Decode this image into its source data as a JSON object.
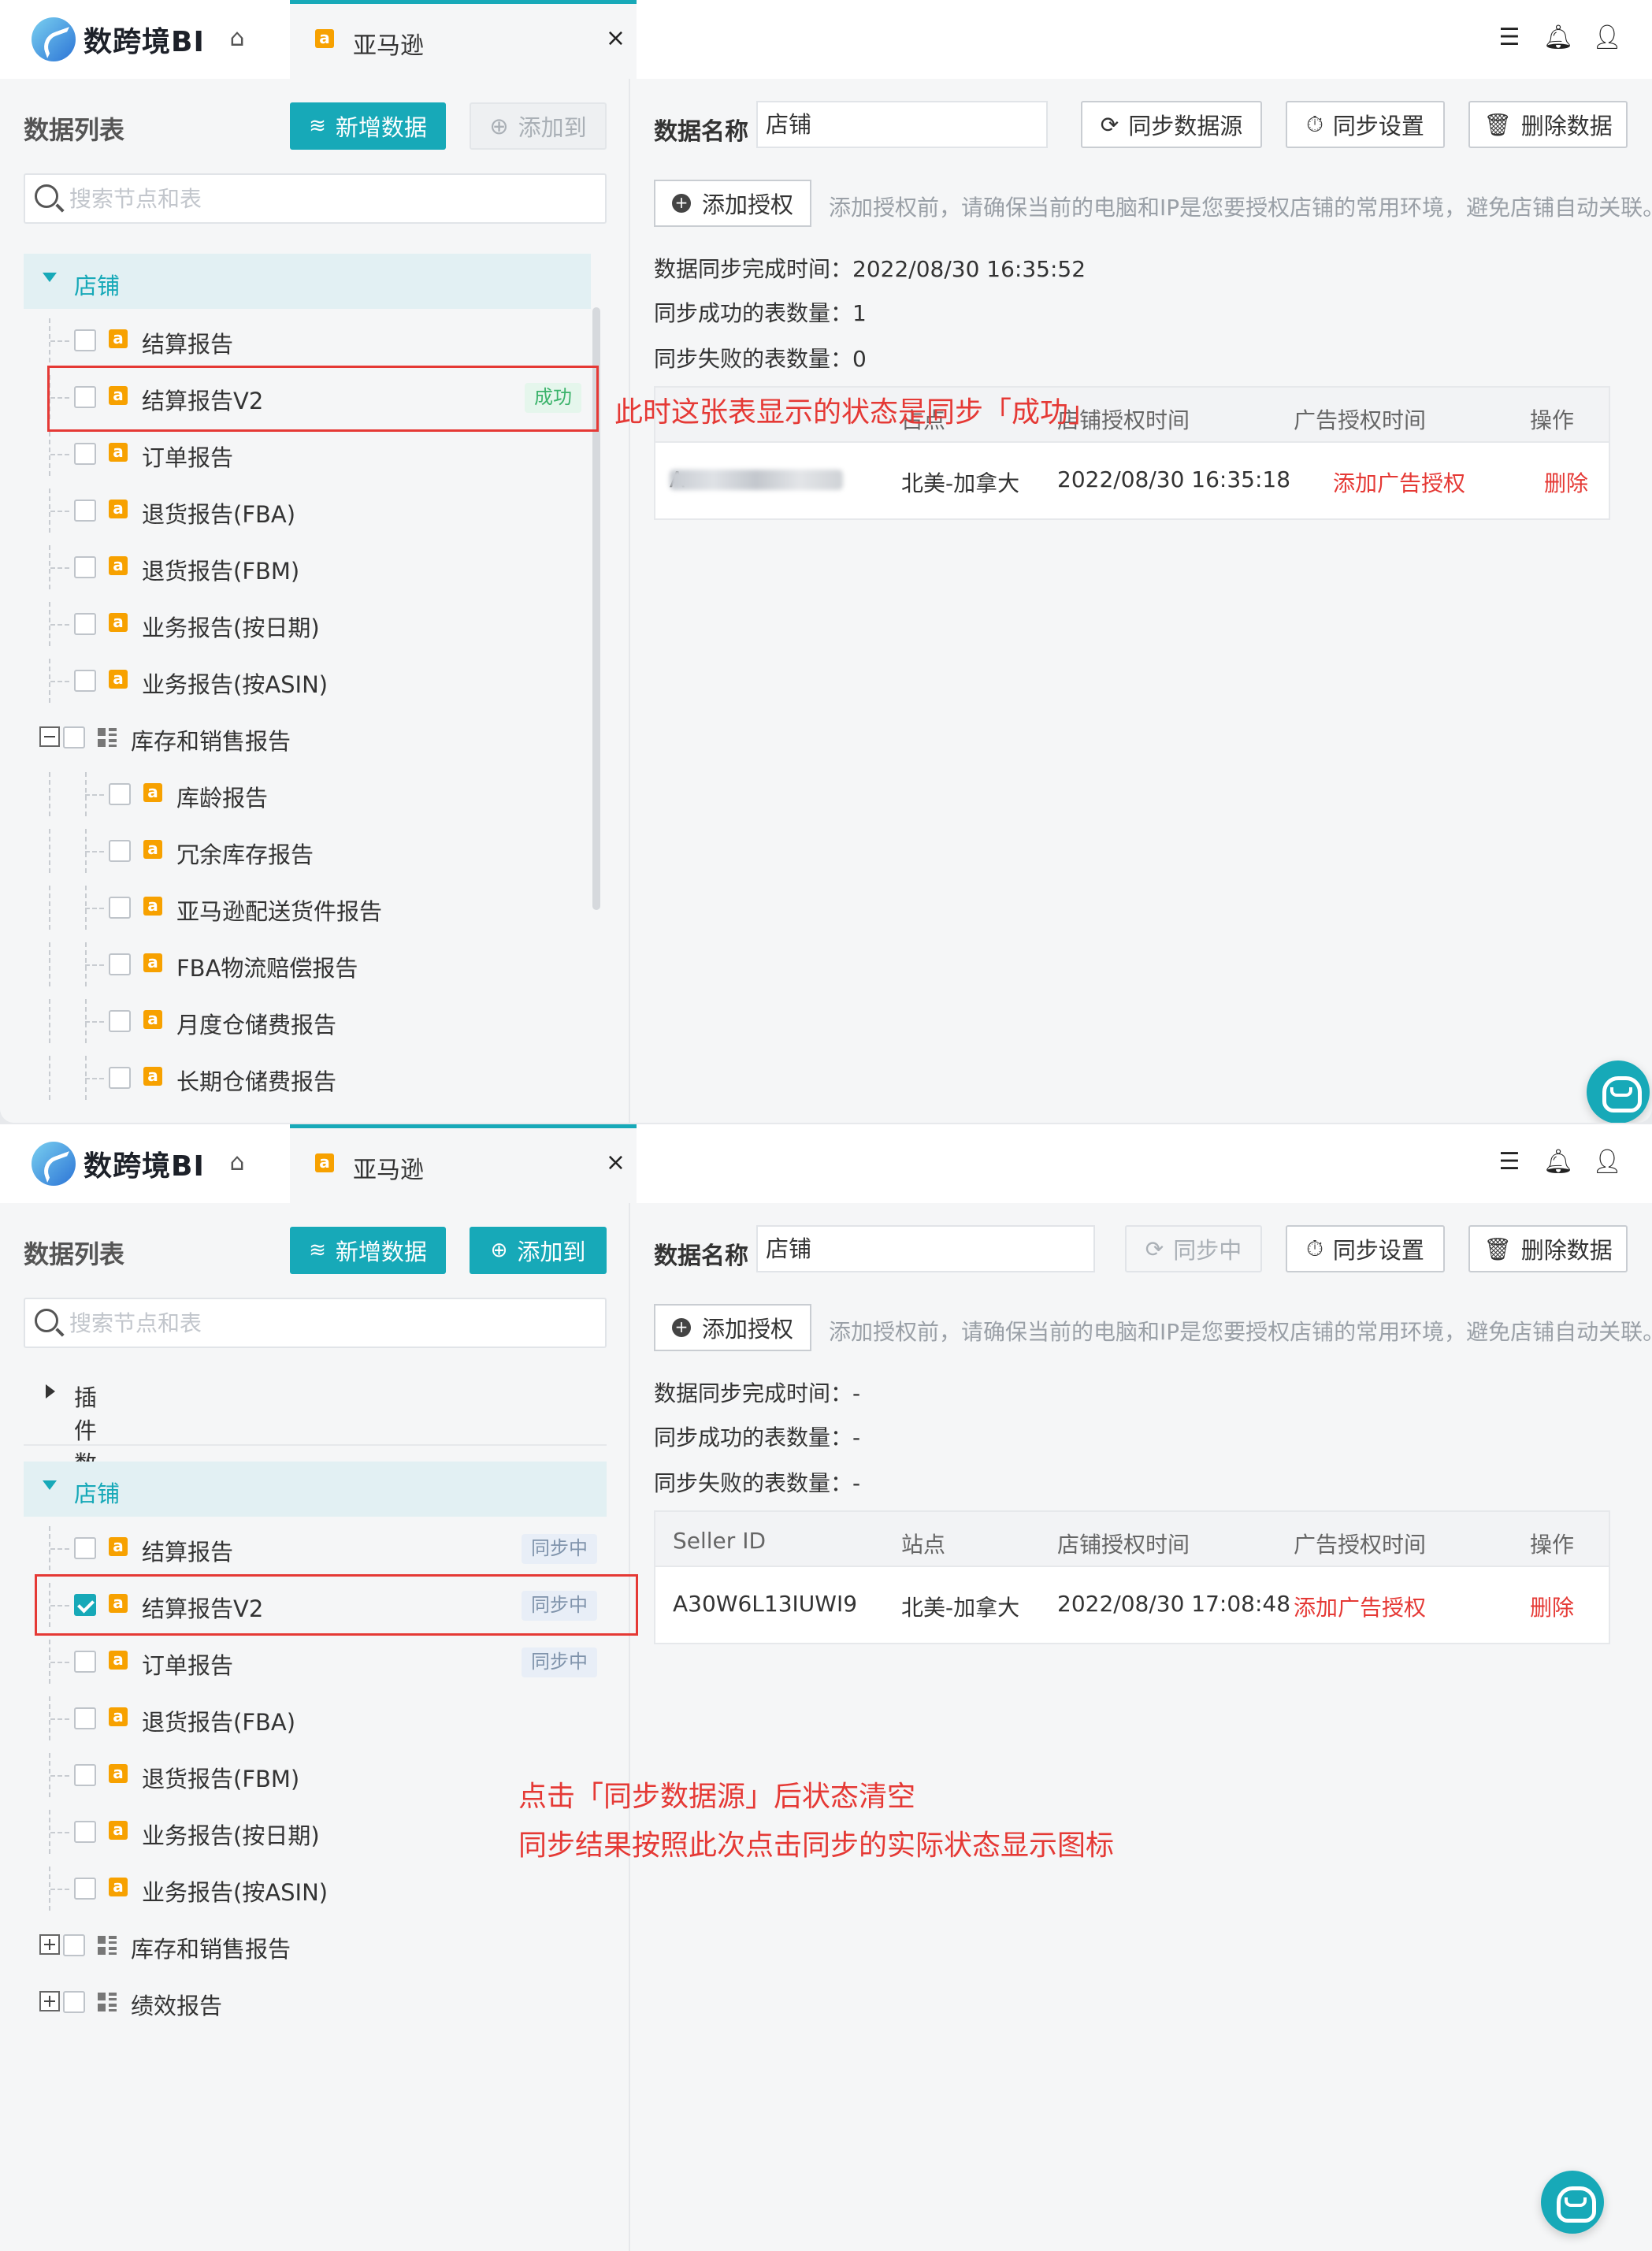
{
  "app": {
    "name": "数跨境BI"
  },
  "tab": {
    "label": "亚马逊",
    "close": "×"
  },
  "left": {
    "title": "数据列表",
    "new_data": "新增数据",
    "add_to": "添加到",
    "search_placeholder": "搜索节点和表",
    "plugin_group": "插件数据",
    "shop_group": "店铺"
  },
  "tree1": [
    {
      "label": "结算报告"
    },
    {
      "label": "结算报告V2",
      "tag": "成功"
    },
    {
      "label": "订单报告"
    },
    {
      "label": "退货报告(FBA)"
    },
    {
      "label": "退货报告(FBM)"
    },
    {
      "label": "业务报告(按日期)"
    },
    {
      "label": "业务报告(按ASIN)"
    },
    {
      "label": "库存和销售报告"
    },
    {
      "label": "库龄报告"
    },
    {
      "label": "冗余库存报告"
    },
    {
      "label": "亚马逊配送货件报告"
    },
    {
      "label": "FBA物流赔偿报告"
    },
    {
      "label": "月度仓储费报告"
    },
    {
      "label": "长期仓储费报告"
    }
  ],
  "tree2": [
    {
      "label": "结算报告",
      "tag": "同步中"
    },
    {
      "label": "结算报告V2",
      "tag": "同步中"
    },
    {
      "label": "订单报告",
      "tag": "同步中"
    },
    {
      "label": "退货报告(FBA)"
    },
    {
      "label": "退货报告(FBM)"
    },
    {
      "label": "业务报告(按日期)"
    },
    {
      "label": "业务报告(按ASIN)"
    },
    {
      "label": "库存和销售报告"
    },
    {
      "label": "绩效报告"
    }
  ],
  "right": {
    "name_label": "数据名称",
    "name_value": "店铺",
    "sync_source": "同步数据源",
    "syncing": "同步中",
    "sync_settings": "同步设置",
    "delete_data": "删除数据",
    "add_auth": "添加授权",
    "hint": "添加授权前，请确保当前的电脑和IP是您要授权店铺的常用环境，避免店铺自动关联。"
  },
  "stats1": {
    "sync_time": "数据同步完成时间：2022/08/30 16:35:52",
    "success": "同步成功的表数量：1",
    "failed": "同步失败的表数量：0"
  },
  "stats2": {
    "sync_time": "数据同步完成时间：-",
    "success": "同步成功的表数量：-",
    "failed": "同步失败的表数量：-"
  },
  "table": {
    "headers": [
      "Seller ID",
      "站点",
      "店铺授权时间",
      "广告授权时间",
      "操作"
    ],
    "header1_partial": [
      "占点",
      "店铺授权时间"
    ],
    "row1": {
      "seller": "A",
      "site": "北美-加拿大",
      "shop_time": "2022/08/30 16:35:18",
      "ad": "添加广告授权",
      "op": "删除"
    },
    "row2": {
      "seller": "A30W6L13IUWI9",
      "site": "北美-加拿大",
      "shop_time": "2022/08/30 17:08:48",
      "ad": "添加广告授权",
      "op": "删除"
    }
  },
  "annotations": {
    "top": "此时这张表显示的状态是同步「成功」",
    "bottom_line1": "点击「同步数据源」后状态清空",
    "bottom_line2": "同步结果按照此次点击同步的实际状态显示图标"
  },
  "colors": {
    "accent": "#17a9b8",
    "annotation": "#e53935",
    "success": "#3bb36b"
  }
}
